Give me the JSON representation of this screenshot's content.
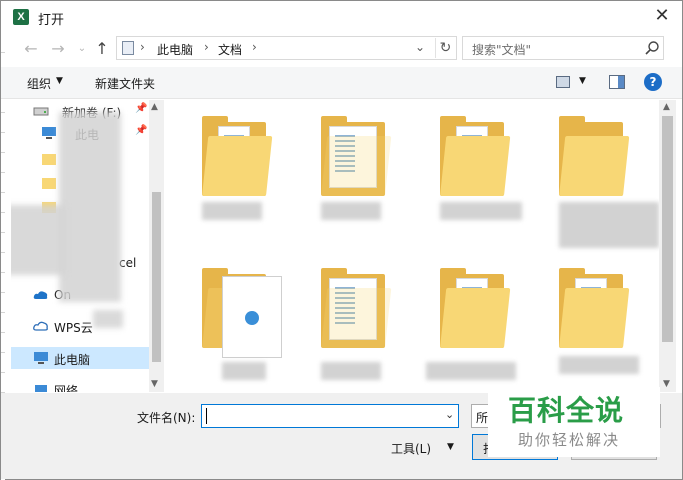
{
  "window": {
    "title": "打开",
    "app_icon_letter": "X"
  },
  "address": {
    "crumbs": [
      "此电脑",
      "文档"
    ],
    "separator": "›"
  },
  "search": {
    "placeholder": "搜索\"文档\""
  },
  "toolbar": {
    "organize": "组织",
    "new_folder": "新建文件夹",
    "help": "?"
  },
  "nav": {
    "items": [
      {
        "label": "新加卷 (F:)"
      },
      {
        "label": "此电"
      },
      {
        "label": "cel"
      },
      {
        "label": "On"
      },
      {
        "label": "WPS云"
      },
      {
        "label": "此电脑"
      },
      {
        "label": "网络"
      }
    ]
  },
  "bottom": {
    "filename_label": "文件名(N):",
    "filename_value": "",
    "filetype": "所",
    "tools_label": "工具(L)",
    "open_label": "打"
  },
  "watermark": {
    "title": "百科全说",
    "subtitle": "助你轻松解决"
  },
  "colors": {
    "accent": "#0078d7",
    "folder": "#f8d775",
    "selected": "#cce8ff",
    "watermark": "#2a9d48"
  }
}
